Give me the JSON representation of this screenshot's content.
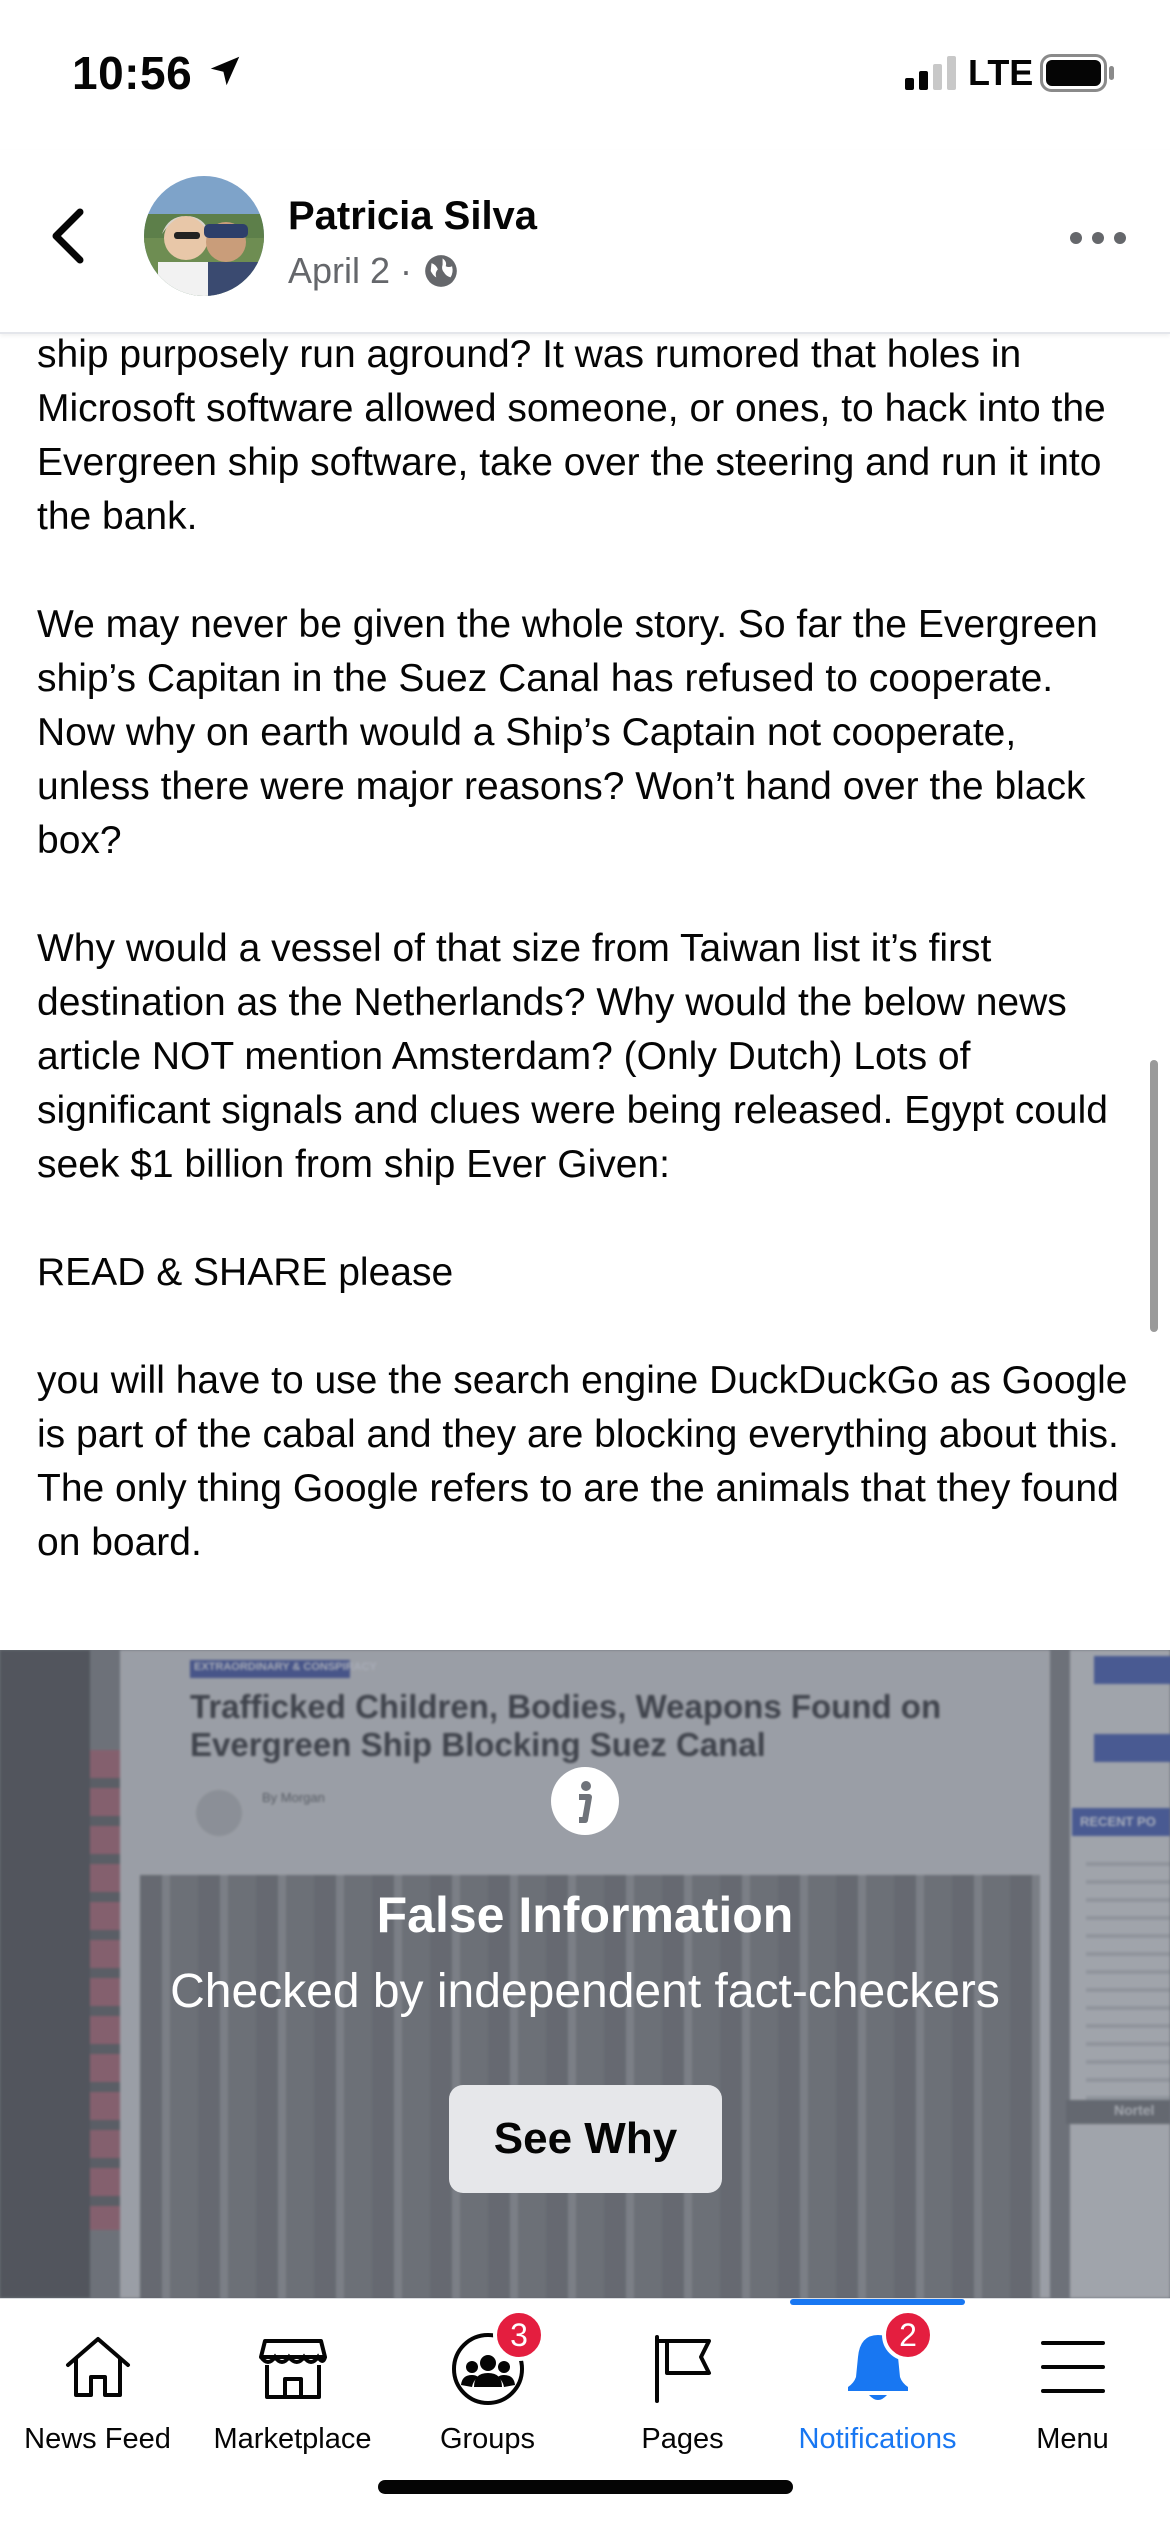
{
  "status_bar": {
    "time": "10:56",
    "network": "LTE"
  },
  "post_header": {
    "author": "Patricia Silva",
    "date": "April 2",
    "separator": "·"
  },
  "post_body": {
    "paragraphs": [
      "ship purposely run aground? It was rumored that holes in Microsoft software allowed someone, or ones, to hack into the Evergreen ship software, take over the steering and run it into the bank.",
      "We may never be given the whole story. So far the Evergreen ship’s Capitan in the Suez Canal has refused to cooperate. Now why on earth would a Ship’s Captain not cooperate, unless there were major reasons? Won’t hand over the black box?",
      "Why would a vessel of that size from Taiwan list it’s first destination as the Netherlands? Why would the below news article NOT mention Amsterdam?  (Only Dutch) Lots of significant signals and clues were being released. Egypt could seek $1 billion from ship Ever Given:",
      "READ & SHARE please",
      "you will have to use the search engine DuckDuckGo as Google is part of the cabal and they are blocking everything about this. The only thing Google refers to are the animals that they found on board."
    ]
  },
  "fact_check": {
    "article_tag": "EXTRAORDINARY & CONSPIRACY",
    "article_headline": "Trafficked Children, Bodies, Weapons Found on Evergreen Ship Blocking Suez Canal",
    "article_byline": "By Morgan",
    "article_recent": "RECENT PO",
    "article_north": "Nortel",
    "title": "False Information",
    "subtitle": "Checked by independent fact-checkers",
    "button_label": "See Why"
  },
  "tabbar": {
    "tabs": [
      {
        "label": "News Feed",
        "icon": "home-icon",
        "badge": null
      },
      {
        "label": "Marketplace",
        "icon": "marketplace-icon",
        "badge": null
      },
      {
        "label": "Groups",
        "icon": "groups-icon",
        "badge": "3"
      },
      {
        "label": "Pages",
        "icon": "flag-icon",
        "badge": null
      },
      {
        "label": "Notifications",
        "icon": "bell-icon",
        "badge": "2"
      },
      {
        "label": "Menu",
        "icon": "hamburger-icon",
        "badge": null
      }
    ],
    "active_tab": "Notifications",
    "active_color": "#1877f2",
    "badge_color": "#e41e3f"
  }
}
